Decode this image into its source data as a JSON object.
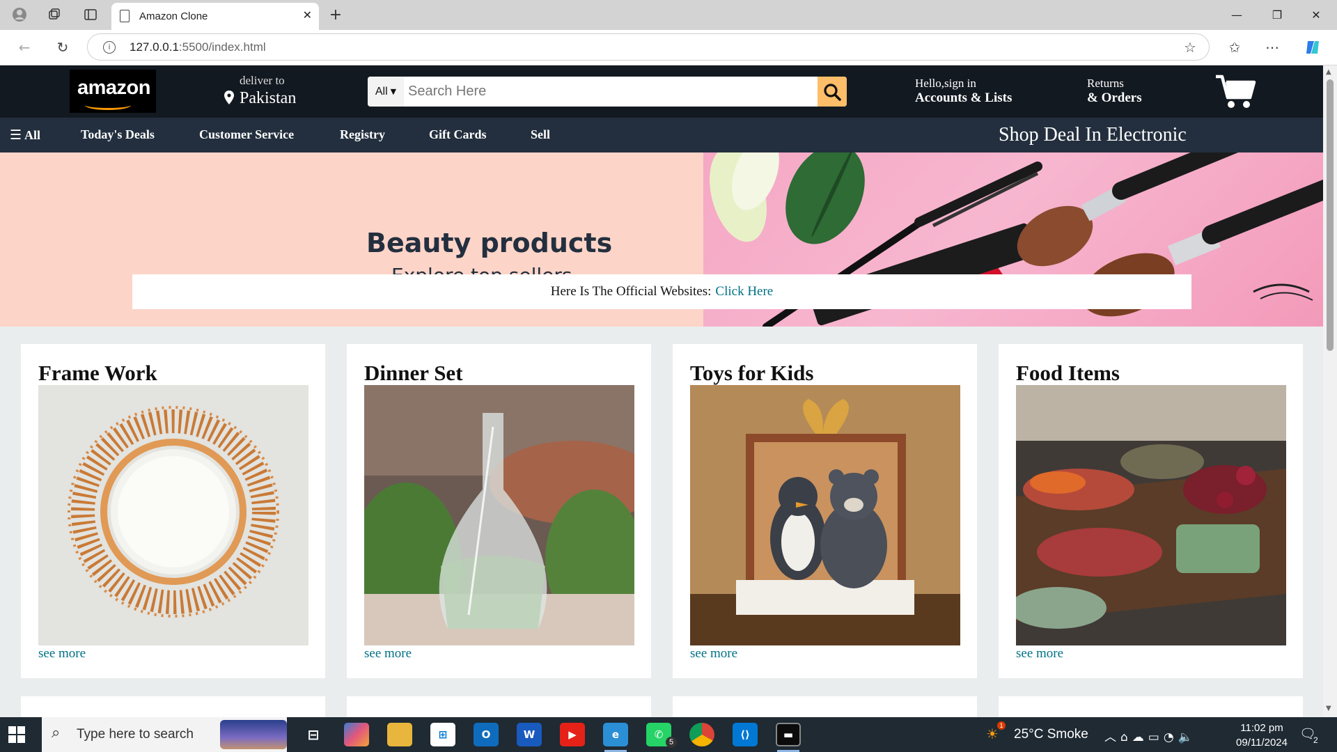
{
  "browser": {
    "tab_title": "Amazon Clone",
    "url_host": "127.0.0.1",
    "url_rest": ":5500/index.html"
  },
  "header": {
    "logo_text": "amazon",
    "deliver_label": "deliver to",
    "deliver_country": "Pakistan",
    "search_category": "All",
    "search_placeholder": "Search Here",
    "account_line1": "Hello,sign in",
    "account_line2": "Accounts & Lists",
    "returns_line1": "Returns",
    "returns_line2": "& Orders"
  },
  "nav": {
    "all": "All",
    "links": [
      "Today's Deals",
      "Customer Service",
      "Registry",
      "Gift Cards",
      "Sell"
    ],
    "deal": "Shop Deal In Electronic"
  },
  "hero": {
    "title": "Beauty products",
    "subtitle": "Explore top sellers",
    "notice_text": "Here Is The Official Websites:",
    "notice_link": "Click Here"
  },
  "cards": [
    {
      "title": "Frame Work",
      "link": "see more"
    },
    {
      "title": "Dinner Set",
      "link": "see more"
    },
    {
      "title": "Toys for Kids",
      "link": "see more"
    },
    {
      "title": "Food Items",
      "link": "see more"
    }
  ],
  "taskbar": {
    "search_placeholder": "Type here to search",
    "weather": "25°C  Smoke",
    "time": "11:02 pm",
    "date": "09/11/2024",
    "whatsapp_badge": "5",
    "notif_count": "2",
    "weather_badge": "1"
  },
  "colors": {
    "header_bg": "#131921",
    "nav_bg": "#232f3e",
    "search_button": "#febd69",
    "link": "#007185",
    "hero_bg": "#fdd4c8"
  }
}
